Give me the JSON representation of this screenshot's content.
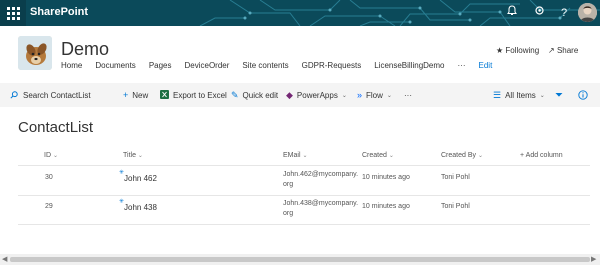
{
  "suitebar": {
    "title": "SharePoint",
    "colors": {
      "bg": "#0b4a5a"
    }
  },
  "site": {
    "title": "Demo",
    "nav": [
      "Home",
      "Documents",
      "Pages",
      "DeviceOrder",
      "Site contents",
      "GDPR-Requests",
      "LicenseBillingDemo",
      "···",
      "Edit"
    ],
    "following": "Following",
    "share": "Share"
  },
  "commandbar": {
    "search_placeholder": "Search ContactList",
    "new": "New",
    "export": "Export to Excel",
    "quick_edit": "Quick edit",
    "powerapps": "PowerApps",
    "flow": "Flow",
    "more": "···",
    "view": "All Items"
  },
  "list": {
    "title": "ContactList",
    "columns": [
      "ID",
      "Title",
      "EMail",
      "Created",
      "Created By",
      "Add column"
    ],
    "rows": [
      {
        "id": "30",
        "title": "John 462",
        "email1": "John.462@mycompany.",
        "email2": "org",
        "created": "10 minutes ago",
        "created_by": "Toni Pohl"
      },
      {
        "id": "29",
        "title": "John 438",
        "email1": "John.438@mycompany.",
        "email2": "org",
        "created": "10 minutes ago",
        "created_by": "Toni Pohl"
      }
    ]
  },
  "accent": "#0078d4"
}
